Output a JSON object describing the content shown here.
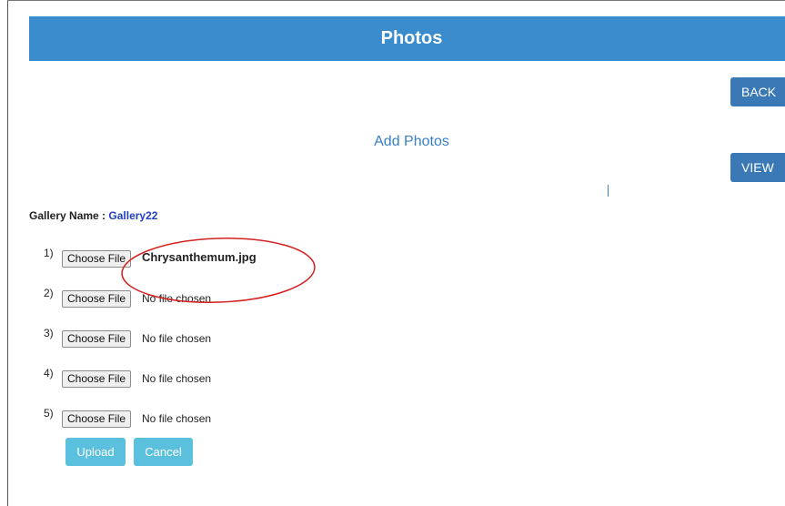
{
  "header": {
    "title": "Photos"
  },
  "actions": {
    "back_label": "BACK",
    "view_label": "VIEW"
  },
  "add_photos": {
    "title": "Add Photos"
  },
  "gallery": {
    "label": "Gallery Name :",
    "name": "Gallery22"
  },
  "file_inputs": [
    {
      "number": "1)",
      "button_label": "Choose File",
      "file_text": "Chrysanthemum.jpg"
    },
    {
      "number": "2)",
      "button_label": "Choose File",
      "file_text": "No file chosen"
    },
    {
      "number": "3)",
      "button_label": "Choose File",
      "file_text": "No file chosen"
    },
    {
      "number": "4)",
      "button_label": "Choose File",
      "file_text": "No file chosen"
    },
    {
      "number": "5)",
      "button_label": "Choose File",
      "file_text": "No file chosen"
    }
  ],
  "form_buttons": {
    "upload_label": "Upload",
    "cancel_label": "Cancel"
  },
  "colors": {
    "header_bg": "#3a8ccd",
    "nav_button_bg": "#3a79b6",
    "form_button_bg": "#5bc0de",
    "gallery_name_color": "#1f3fbf",
    "annotation_stroke": "#d42020"
  }
}
